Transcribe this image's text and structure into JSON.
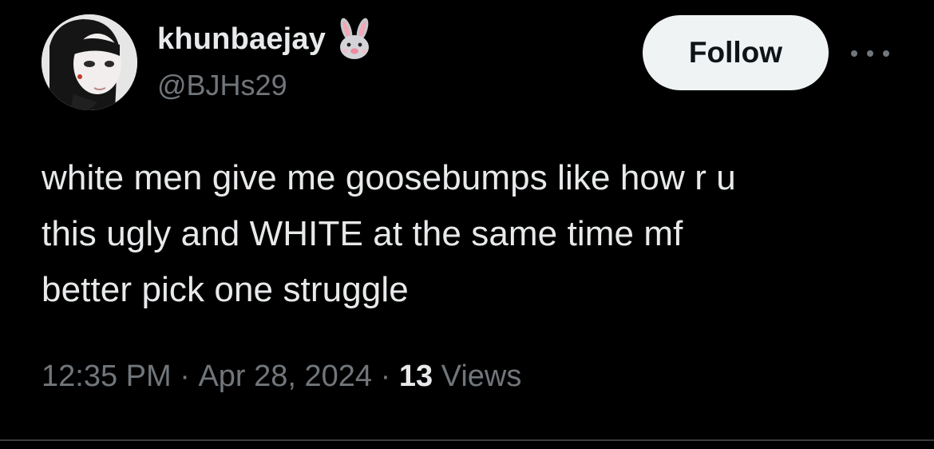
{
  "user": {
    "display_name": "khunbaejay",
    "name_emoji_icon": "rabbit-face-icon",
    "handle": "@BJHs29"
  },
  "actions": {
    "follow_label": "Follow",
    "more_icon": "more-horizontal-icon"
  },
  "tweet": {
    "text": "white men give me goosebumps like how r u\nthis ugly and WHITE at the same time mf\nbetter pick one struggle"
  },
  "meta": {
    "time": "12:35 PM",
    "separator": " · ",
    "date": "Apr 28, 2024",
    "views_count": "13",
    "views_label": "Views"
  },
  "colors": {
    "background": "#000000",
    "primary_text": "#e7e9ea",
    "secondary_text": "#71767b",
    "follow_button_bg": "#eff3f4",
    "divider": "#3a3d40"
  }
}
